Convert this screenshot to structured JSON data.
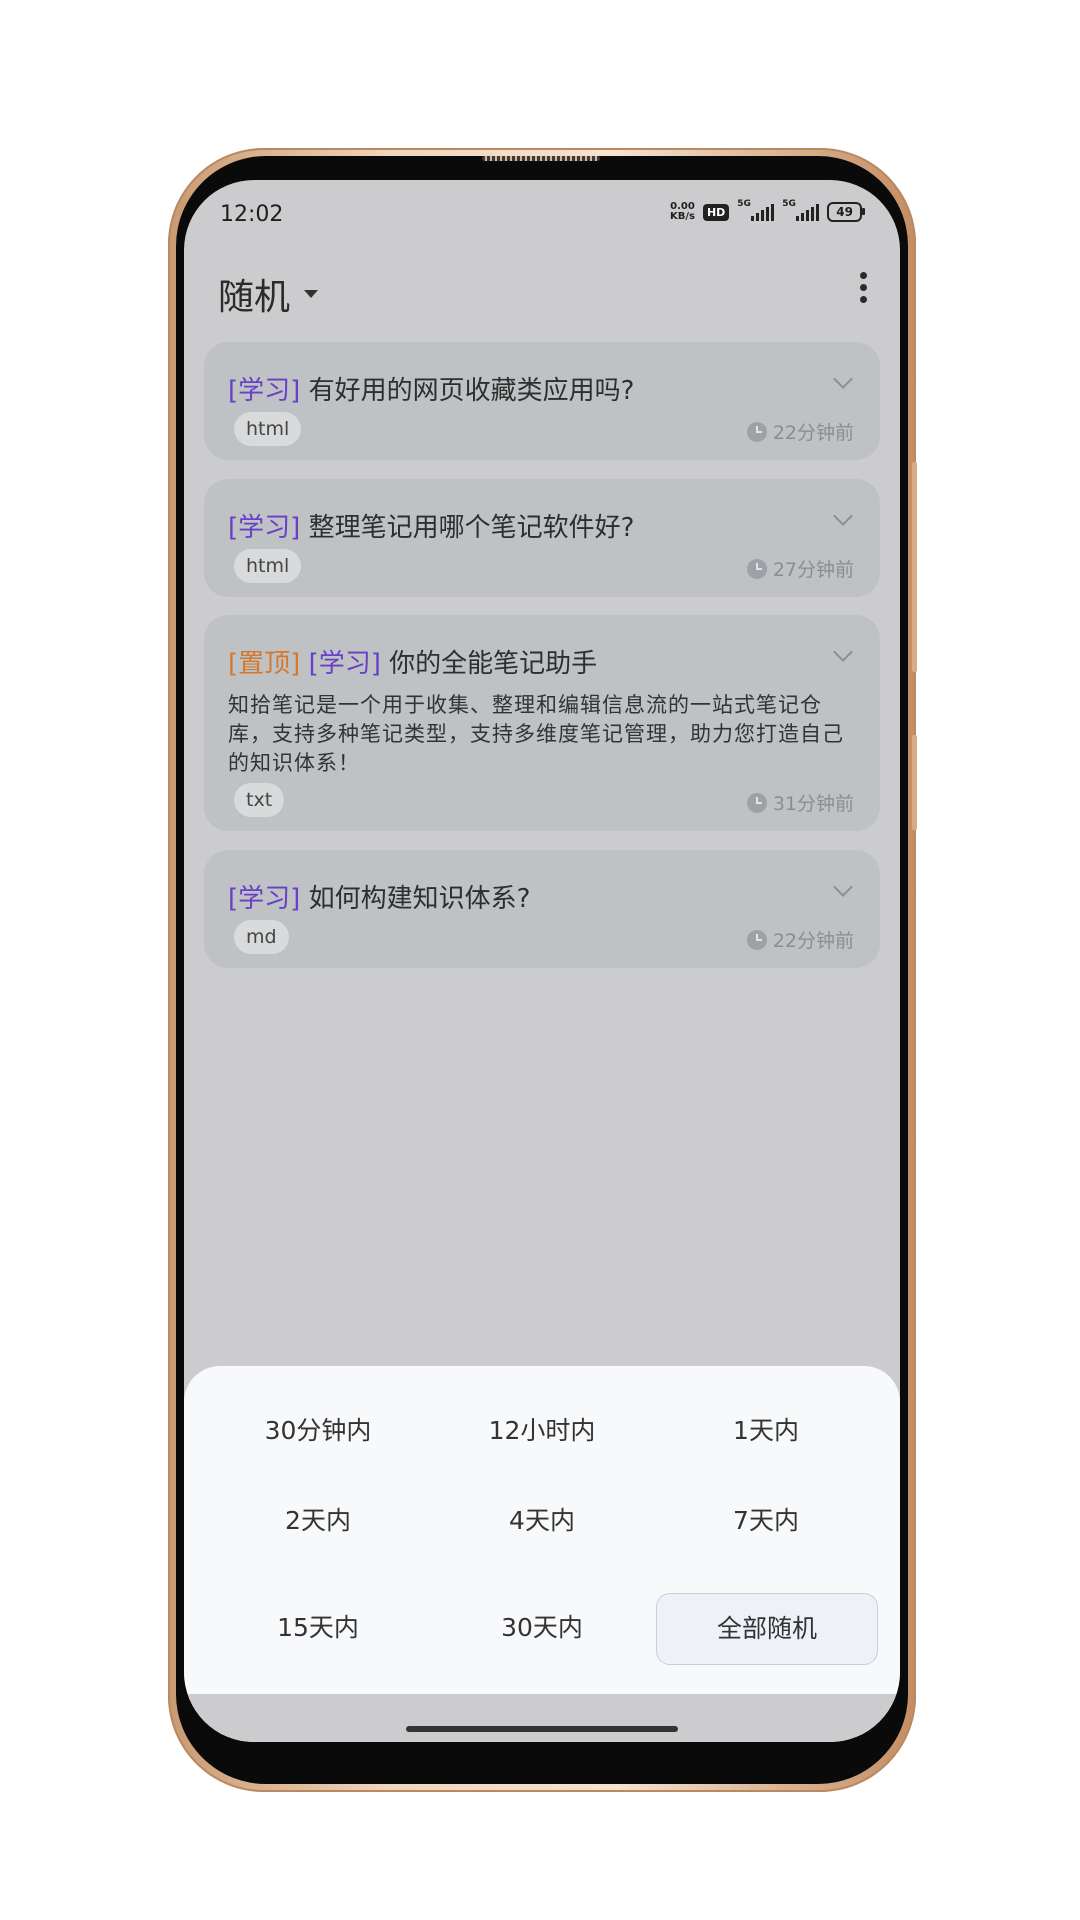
{
  "status_bar": {
    "time": "12:02",
    "net_speed_value": "0.00",
    "net_speed_unit": "KB/s",
    "hd_label": "HD",
    "signal1_label": "5G",
    "signal2_label": "5G",
    "battery": "49"
  },
  "app_bar": {
    "title": "随机",
    "dropdown_icon": "caret-down-icon",
    "menu_icon": "more-vertical-icon"
  },
  "notes": [
    {
      "pin_tag": "",
      "category_tag": "[学习]",
      "title": "有好用的网页收藏类应用吗?",
      "body": "",
      "type": "html",
      "time": "22分钟前"
    },
    {
      "pin_tag": "",
      "category_tag": "[学习]",
      "title": "整理笔记用哪个笔记软件好?",
      "body": "",
      "type": "html",
      "time": "27分钟前"
    },
    {
      "pin_tag": "[置顶]",
      "category_tag": "[学习]",
      "title": "你的全能笔记助手",
      "body": "知拾笔记是一个用于收集、整理和编辑信息流的一站式笔记仓库，支持多种笔记类型，支持多维度笔记管理，助力您打造自己的知识体系！",
      "type": "txt",
      "time": "31分钟前"
    },
    {
      "pin_tag": "",
      "category_tag": "[学习]",
      "title": "如何构建知识体系?",
      "body": "",
      "type": "md",
      "time": "22分钟前"
    }
  ],
  "time_filter": {
    "options": [
      "30分钟内",
      "12小时内",
      "1天内",
      "2天内",
      "4天内",
      "7天内",
      "15天内",
      "30天内",
      "全部随机"
    ],
    "selected": "全部随机"
  },
  "colors": {
    "study_tag": "#6a3fc7",
    "pin_tag": "#d4782f",
    "card_bg": "#bfc2c4",
    "sheet_bg": "#f8f9fb"
  }
}
